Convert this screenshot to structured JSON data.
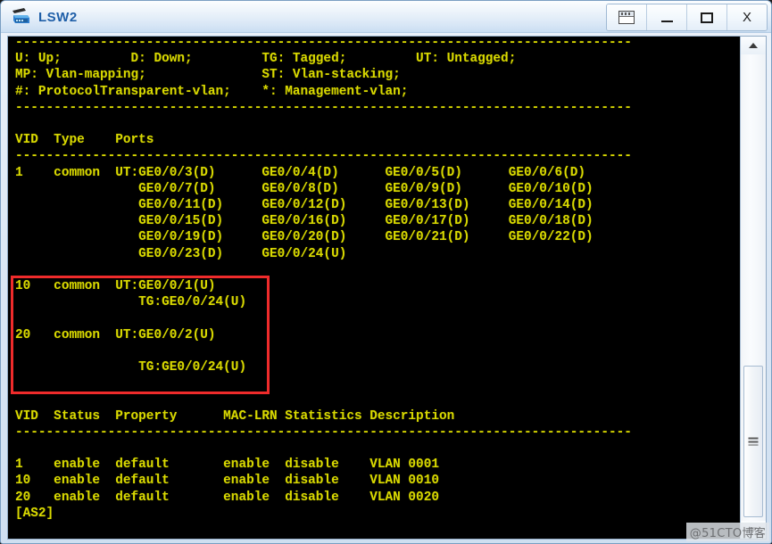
{
  "window": {
    "title": "LSW2",
    "app_icon": "switch-icon",
    "controls": [
      {
        "name": "restore-list-button",
        "glyph": "restore-icon",
        "label": ""
      },
      {
        "name": "minimize-button",
        "glyph": "minimize-icon",
        "label": ""
      },
      {
        "name": "maximize-button",
        "glyph": "maximize-icon",
        "label": ""
      },
      {
        "name": "close-button",
        "glyph": "close-icon",
        "label": "X"
      }
    ]
  },
  "terminal": {
    "foreground_color": "#d9d900",
    "background_color": "#000000",
    "content": "--------------------------------------------------------------------------------\nU: Up;         D: Down;         TG: Tagged;         UT: Untagged;\nMP: Vlan-mapping;               ST: Vlan-stacking;\n#: ProtocolTransparent-vlan;    *: Management-vlan;\n--------------------------------------------------------------------------------\n\nVID  Type    Ports\n--------------------------------------------------------------------------------\n1    common  UT:GE0/0/3(D)      GE0/0/4(D)      GE0/0/5(D)      GE0/0/6(D)\n                GE0/0/7(D)      GE0/0/8(D)      GE0/0/9(D)      GE0/0/10(D)\n                GE0/0/11(D)     GE0/0/12(D)     GE0/0/13(D)     GE0/0/14(D)\n                GE0/0/15(D)     GE0/0/16(D)     GE0/0/17(D)     GE0/0/18(D)\n                GE0/0/19(D)     GE0/0/20(D)     GE0/0/21(D)     GE0/0/22(D)\n                GE0/0/23(D)     GE0/0/24(U)\n\n10   common  UT:GE0/0/1(U)\n                TG:GE0/0/24(U)\n\n20   common  UT:GE0/0/2(U)\n\n                TG:GE0/0/24(U)\n\n\nVID  Status  Property      MAC-LRN Statistics Description\n--------------------------------------------------------------------------------\n\n1    enable  default       enable  disable    VLAN 0001\n10   enable  default       enable  disable    VLAN 0010\n20   enable  default       enable  disable    VLAN 0020\n[AS2]"
  },
  "annotation": {
    "highlight_box_color": "#ef2b2b",
    "highlight_box_name": "vlan-10-20-highlight"
  },
  "scrollbar": {
    "up_arrow": "scroll-up-arrow",
    "down_arrow": "scroll-down-arrow",
    "thumb": "scroll-thumb"
  },
  "watermark": {
    "text": "@51CTO博客"
  },
  "vlan_port_table": {
    "headers": [
      "VID",
      "Type",
      "Ports"
    ],
    "rows": [
      {
        "vid": "1",
        "type": "common",
        "ports": [
          "UT:GE0/0/3(D)",
          "GE0/0/4(D)",
          "GE0/0/5(D)",
          "GE0/0/6(D)",
          "GE0/0/7(D)",
          "GE0/0/8(D)",
          "GE0/0/9(D)",
          "GE0/0/10(D)",
          "GE0/0/11(D)",
          "GE0/0/12(D)",
          "GE0/0/13(D)",
          "GE0/0/14(D)",
          "GE0/0/15(D)",
          "GE0/0/16(D)",
          "GE0/0/17(D)",
          "GE0/0/18(D)",
          "GE0/0/19(D)",
          "GE0/0/20(D)",
          "GE0/0/21(D)",
          "GE0/0/22(D)",
          "GE0/0/23(D)",
          "GE0/0/24(U)"
        ]
      },
      {
        "vid": "10",
        "type": "common",
        "ports": [
          "UT:GE0/0/1(U)",
          "TG:GE0/0/24(U)"
        ]
      },
      {
        "vid": "20",
        "type": "common",
        "ports": [
          "UT:GE0/0/2(U)",
          "TG:GE0/0/24(U)"
        ]
      }
    ]
  },
  "vlan_status_table": {
    "headers": [
      "VID",
      "Status",
      "Property",
      "MAC-LRN",
      "Statistics",
      "Description"
    ],
    "rows": [
      [
        "1",
        "enable",
        "default",
        "enable",
        "disable",
        "VLAN 0001"
      ],
      [
        "10",
        "enable",
        "default",
        "enable",
        "disable",
        "VLAN 0010"
      ],
      [
        "20",
        "enable",
        "default",
        "enable",
        "disable",
        "VLAN 0020"
      ]
    ]
  },
  "legend": {
    "entries": [
      "U: Up;",
      "D: Down;",
      "TG: Tagged;",
      "UT: Untagged;",
      "MP: Vlan-mapping;",
      "ST: Vlan-stacking;",
      "#: ProtocolTransparent-vlan;",
      "*: Management-vlan;"
    ]
  },
  "prompt": "[AS2]"
}
